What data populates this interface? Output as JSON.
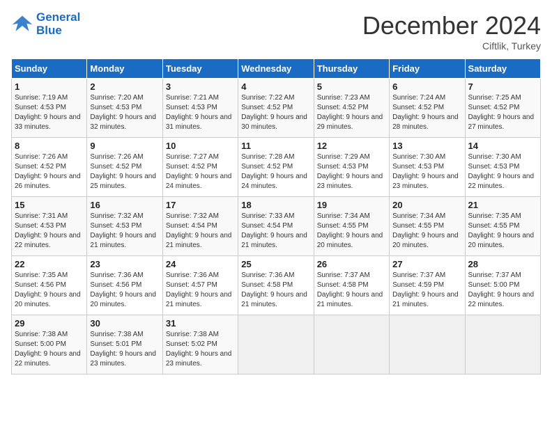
{
  "logo": {
    "line1": "General",
    "line2": "Blue"
  },
  "title": "December 2024",
  "location": "Ciftlik, Turkey",
  "days_header": [
    "Sunday",
    "Monday",
    "Tuesday",
    "Wednesday",
    "Thursday",
    "Friday",
    "Saturday"
  ],
  "weeks": [
    [
      {
        "day": "1",
        "sunrise": "7:19 AM",
        "sunset": "4:53 PM",
        "daylight": "9 hours and 33 minutes."
      },
      {
        "day": "2",
        "sunrise": "7:20 AM",
        "sunset": "4:53 PM",
        "daylight": "9 hours and 32 minutes."
      },
      {
        "day": "3",
        "sunrise": "7:21 AM",
        "sunset": "4:53 PM",
        "daylight": "9 hours and 31 minutes."
      },
      {
        "day": "4",
        "sunrise": "7:22 AM",
        "sunset": "4:52 PM",
        "daylight": "9 hours and 30 minutes."
      },
      {
        "day": "5",
        "sunrise": "7:23 AM",
        "sunset": "4:52 PM",
        "daylight": "9 hours and 29 minutes."
      },
      {
        "day": "6",
        "sunrise": "7:24 AM",
        "sunset": "4:52 PM",
        "daylight": "9 hours and 28 minutes."
      },
      {
        "day": "7",
        "sunrise": "7:25 AM",
        "sunset": "4:52 PM",
        "daylight": "9 hours and 27 minutes."
      }
    ],
    [
      {
        "day": "8",
        "sunrise": "7:26 AM",
        "sunset": "4:52 PM",
        "daylight": "9 hours and 26 minutes."
      },
      {
        "day": "9",
        "sunrise": "7:26 AM",
        "sunset": "4:52 PM",
        "daylight": "9 hours and 25 minutes."
      },
      {
        "day": "10",
        "sunrise": "7:27 AM",
        "sunset": "4:52 PM",
        "daylight": "9 hours and 24 minutes."
      },
      {
        "day": "11",
        "sunrise": "7:28 AM",
        "sunset": "4:52 PM",
        "daylight": "9 hours and 24 minutes."
      },
      {
        "day": "12",
        "sunrise": "7:29 AM",
        "sunset": "4:53 PM",
        "daylight": "9 hours and 23 minutes."
      },
      {
        "day": "13",
        "sunrise": "7:30 AM",
        "sunset": "4:53 PM",
        "daylight": "9 hours and 23 minutes."
      },
      {
        "day": "14",
        "sunrise": "7:30 AM",
        "sunset": "4:53 PM",
        "daylight": "9 hours and 22 minutes."
      }
    ],
    [
      {
        "day": "15",
        "sunrise": "7:31 AM",
        "sunset": "4:53 PM",
        "daylight": "9 hours and 22 minutes."
      },
      {
        "day": "16",
        "sunrise": "7:32 AM",
        "sunset": "4:53 PM",
        "daylight": "9 hours and 21 minutes."
      },
      {
        "day": "17",
        "sunrise": "7:32 AM",
        "sunset": "4:54 PM",
        "daylight": "9 hours and 21 minutes."
      },
      {
        "day": "18",
        "sunrise": "7:33 AM",
        "sunset": "4:54 PM",
        "daylight": "9 hours and 21 minutes."
      },
      {
        "day": "19",
        "sunrise": "7:34 AM",
        "sunset": "4:55 PM",
        "daylight": "9 hours and 20 minutes."
      },
      {
        "day": "20",
        "sunrise": "7:34 AM",
        "sunset": "4:55 PM",
        "daylight": "9 hours and 20 minutes."
      },
      {
        "day": "21",
        "sunrise": "7:35 AM",
        "sunset": "4:55 PM",
        "daylight": "9 hours and 20 minutes."
      }
    ],
    [
      {
        "day": "22",
        "sunrise": "7:35 AM",
        "sunset": "4:56 PM",
        "daylight": "9 hours and 20 minutes."
      },
      {
        "day": "23",
        "sunrise": "7:36 AM",
        "sunset": "4:56 PM",
        "daylight": "9 hours and 20 minutes."
      },
      {
        "day": "24",
        "sunrise": "7:36 AM",
        "sunset": "4:57 PM",
        "daylight": "9 hours and 21 minutes."
      },
      {
        "day": "25",
        "sunrise": "7:36 AM",
        "sunset": "4:58 PM",
        "daylight": "9 hours and 21 minutes."
      },
      {
        "day": "26",
        "sunrise": "7:37 AM",
        "sunset": "4:58 PM",
        "daylight": "9 hours and 21 minutes."
      },
      {
        "day": "27",
        "sunrise": "7:37 AM",
        "sunset": "4:59 PM",
        "daylight": "9 hours and 21 minutes."
      },
      {
        "day": "28",
        "sunrise": "7:37 AM",
        "sunset": "5:00 PM",
        "daylight": "9 hours and 22 minutes."
      }
    ],
    [
      {
        "day": "29",
        "sunrise": "7:38 AM",
        "sunset": "5:00 PM",
        "daylight": "9 hours and 22 minutes."
      },
      {
        "day": "30",
        "sunrise": "7:38 AM",
        "sunset": "5:01 PM",
        "daylight": "9 hours and 23 minutes."
      },
      {
        "day": "31",
        "sunrise": "7:38 AM",
        "sunset": "5:02 PM",
        "daylight": "9 hours and 23 minutes."
      },
      null,
      null,
      null,
      null
    ]
  ],
  "labels": {
    "sunrise": "Sunrise:",
    "sunset": "Sunset:",
    "daylight": "Daylight:"
  }
}
